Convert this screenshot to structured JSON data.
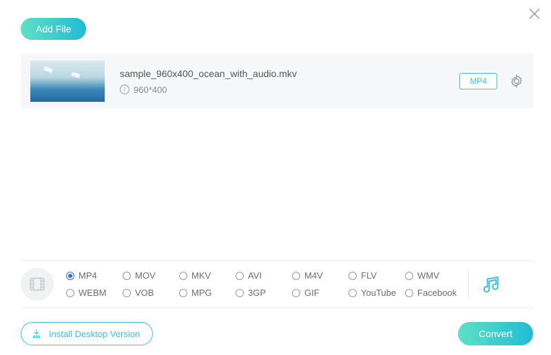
{
  "header": {
    "add_file_label": "Add File"
  },
  "file": {
    "name": "sample_960x400_ocean_with_audio.mkv",
    "dimensions": "960*400",
    "output_format_badge": "MP4"
  },
  "formats": {
    "selected": "MP4",
    "options": [
      "MP4",
      "MOV",
      "MKV",
      "AVI",
      "M4V",
      "FLV",
      "WMV",
      "WEBM",
      "VOB",
      "MPG",
      "3GP",
      "GIF",
      "YouTube",
      "Facebook"
    ]
  },
  "footer": {
    "install_label": "Install Desktop Version",
    "convert_label": "Convert"
  },
  "colors": {
    "accent": "#20bcd6",
    "accent2": "#5fe0c5",
    "radio_selected": "#2a6fe0"
  }
}
